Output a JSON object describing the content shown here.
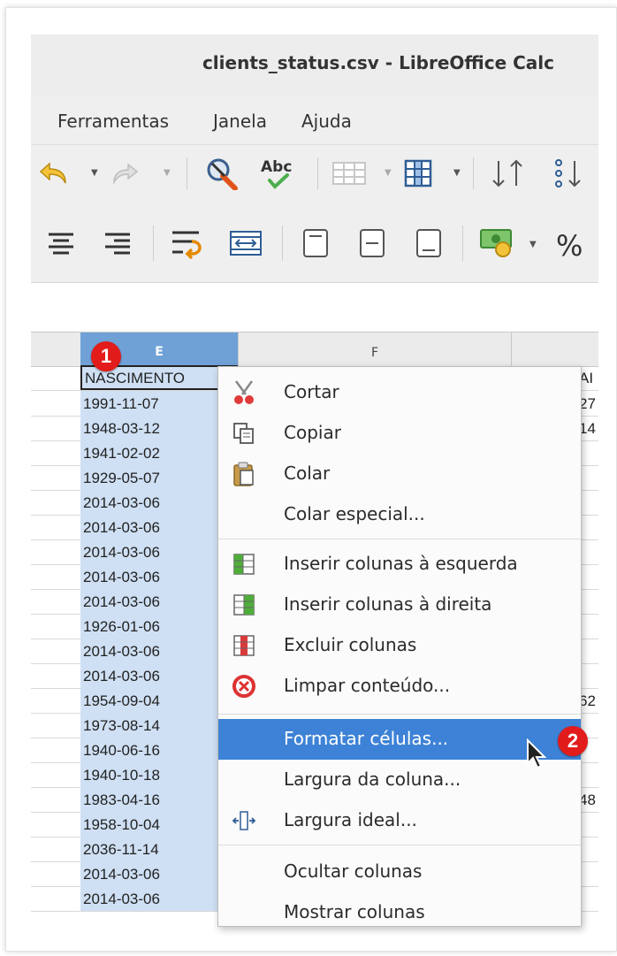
{
  "window": {
    "title": "clients_status.csv - LibreOffice Calc"
  },
  "menu": [
    "Ferramentas",
    "Janela",
    "Ajuda"
  ],
  "toolbar": {
    "row1_icons": [
      "undo-icon",
      "redo-icon",
      "clear-formatting-icon",
      "spellcheck-icon",
      "row-icon",
      "column-icon",
      "sort-ascending-icon",
      "sort-descending-icon"
    ],
    "spellcheck_text": "Abc",
    "row2_icons": [
      "align-center-icon",
      "align-right-icon",
      "wrap-text-icon",
      "merge-center-icon",
      "align-top-icon",
      "align-middle-icon",
      "align-bottom-icon",
      "currency-icon",
      "percent-icon"
    ],
    "percent_symbol": "%"
  },
  "sheet": {
    "column_e": "E",
    "column_f": "F",
    "header_cell": "NASCIMENTO",
    "header_col_g": "AI",
    "rows": [
      {
        "e": "1991-11-07",
        "g": "27"
      },
      {
        "e": "1948-03-12",
        "g": "14"
      },
      {
        "e": "1941-02-02",
        "g": ""
      },
      {
        "e": "1929-05-07",
        "g": ""
      },
      {
        "e": "2014-03-06",
        "g": ""
      },
      {
        "e": "2014-03-06",
        "g": ""
      },
      {
        "e": "2014-03-06",
        "g": ""
      },
      {
        "e": "2014-03-06",
        "g": ""
      },
      {
        "e": "2014-03-06",
        "g": ""
      },
      {
        "e": "1926-01-06",
        "g": ""
      },
      {
        "e": "2014-03-06",
        "g": ""
      },
      {
        "e": "2014-03-06",
        "g": ""
      },
      {
        "e": "1954-09-04",
        "g": "62"
      },
      {
        "e": "1973-08-14",
        "g": ""
      },
      {
        "e": "1940-06-16",
        "g": ""
      },
      {
        "e": "1940-10-18",
        "g": ""
      },
      {
        "e": "1983-04-16",
        "g": "48"
      },
      {
        "e": "1958-10-04",
        "g": ""
      },
      {
        "e": "2036-11-14",
        "g": ""
      },
      {
        "e": "2014-03-06",
        "g": ""
      },
      {
        "e": "2014-03-06",
        "g": ""
      }
    ]
  },
  "context_menu": {
    "items": [
      {
        "label": "Cortar",
        "icon": "scissors-icon"
      },
      {
        "label": "Copiar",
        "icon": "copy-icon"
      },
      {
        "label": "Colar",
        "icon": "paste-icon"
      },
      {
        "label": "Colar especial...",
        "icon": ""
      },
      {
        "label": "Inserir colunas à esquerda",
        "icon": "insert-column-left-icon"
      },
      {
        "label": "Inserir colunas à direita",
        "icon": "insert-column-right-icon"
      },
      {
        "label": "Excluir colunas",
        "icon": "delete-columns-icon"
      },
      {
        "label": "Limpar conteúdo...",
        "icon": "clear-contents-icon"
      },
      {
        "label": "Formatar células...",
        "icon": ""
      },
      {
        "label": "Largura da coluna...",
        "icon": ""
      },
      {
        "label": "Largura ideal...",
        "icon": "optimal-width-icon"
      },
      {
        "label": "Ocultar colunas",
        "icon": ""
      },
      {
        "label": "Mostrar colunas",
        "icon": ""
      }
    ],
    "highlighted": "Formatar células..."
  },
  "annotations": {
    "step1": "1",
    "step2": "2"
  },
  "colors": {
    "highlight": "#3d82d6",
    "selection": "#cfe0f4",
    "badge": "#e21b1b"
  }
}
